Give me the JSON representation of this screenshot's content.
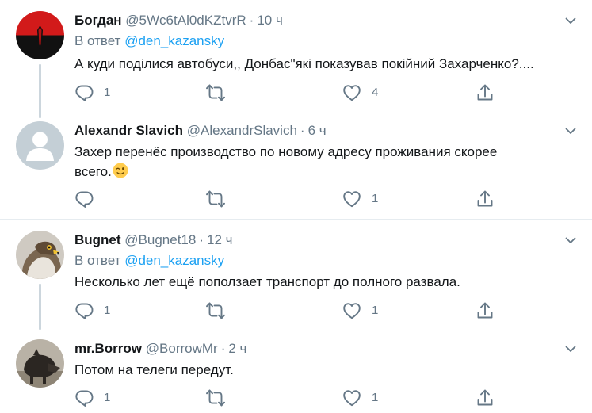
{
  "tweets": [
    {
      "name": "Богдан",
      "handle": "@5Wc6tAl0dKZtvrR",
      "time": "10 ч",
      "reply_prefix": "В ответ",
      "reply_to": "@den_kazansky",
      "text": "А куди поділися автобуси,, Донбас\"які показував покійний Захарченко?....",
      "replies": "1",
      "retweets": "",
      "likes": "4"
    },
    {
      "name": "Alexandr Slavich",
      "handle": "@AlexandrSlavich",
      "time": "6 ч",
      "text_line1": "Захер перенёс производство по новому адресу проживания скорее",
      "text_line2": "всего.",
      "emoji": "winking-face",
      "replies": "",
      "retweets": "",
      "likes": "1"
    },
    {
      "name": "Bugnet",
      "handle": "@Bugnet18",
      "time": "12 ч",
      "reply_prefix": "В ответ",
      "reply_to": "@den_kazansky",
      "text": "Несколько лет ещё поползает транспорт до полного развала.",
      "replies": "1",
      "retweets": "",
      "likes": "1"
    },
    {
      "name": "mr.Borrow",
      "handle": "@BorrowMr",
      "time": "2 ч",
      "text": "Потом на телеги передут.",
      "replies": "1",
      "retweets": "",
      "likes": "1"
    }
  ],
  "separator": "·",
  "icons": {
    "reply": "reply-icon",
    "retweet": "retweet-icon",
    "like": "heart-icon",
    "share": "share-icon",
    "more": "chevron-down-icon"
  },
  "colors": {
    "text": "#14171a",
    "secondary": "#657786",
    "link": "#1da1f2",
    "icon": "#657786",
    "divider": "#e6ecf0",
    "thread_line": "#ccd6dd"
  }
}
